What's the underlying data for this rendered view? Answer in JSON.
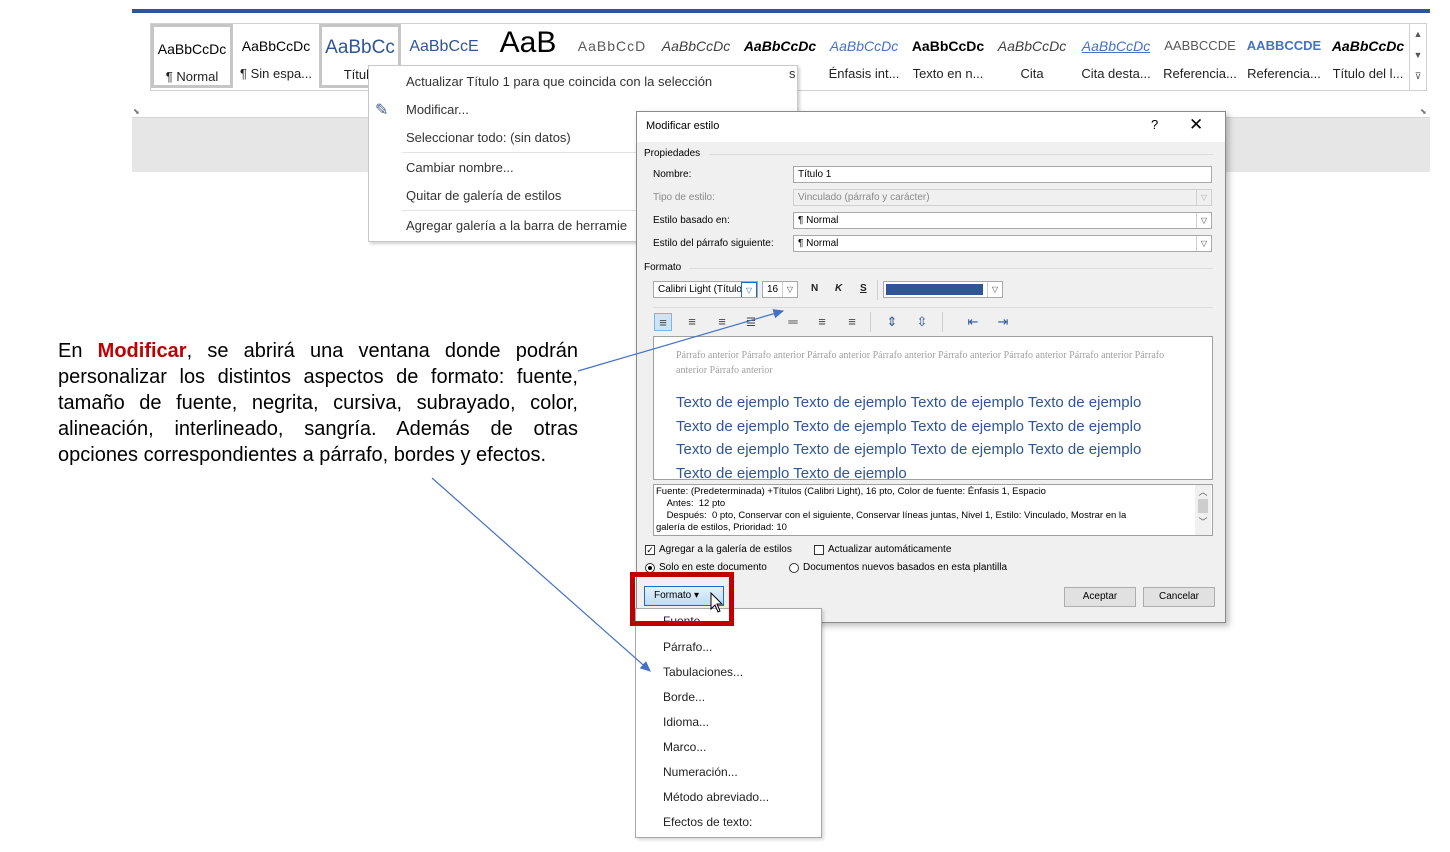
{
  "ribbon": {
    "styles": [
      {
        "preview": "AaBbCcDc",
        "label": "¶ Normal"
      },
      {
        "preview": "AaBbCcDc",
        "label": "¶ Sin espa..."
      },
      {
        "preview": "AaBbCc",
        "label": "Título"
      },
      {
        "preview": "AaBbCcE",
        "label": ""
      },
      {
        "preview": "AaB",
        "label": ""
      },
      {
        "preview": "AaBbCcD",
        "label": ""
      },
      {
        "preview": "AaBbCcDc",
        "label": ""
      },
      {
        "preview": "AaBbCcDc",
        "label": ""
      },
      {
        "preview": "AaBbCcDc",
        "label": "Énfasis int..."
      },
      {
        "preview": "AaBbCcDc",
        "label": "Texto en n..."
      },
      {
        "preview": "AaBbCcDc",
        "label": "Cita"
      },
      {
        "preview": "AaBbCcDc",
        "label": "Cita desta..."
      },
      {
        "preview": "AABBCCDE",
        "label": "Referencia..."
      },
      {
        "preview": "AABBCCDE",
        "label": "Referencia..."
      },
      {
        "preview": "AaBbCcDc",
        "label": "Título del l..."
      }
    ],
    "scroll_up": "▲",
    "scroll_down": "▼",
    "scroll_more": "⊽",
    "brand_color": "#2b579a"
  },
  "context_menu": {
    "items": [
      "Actualizar Título 1 para que coincida con la selección",
      "Modificar...",
      "Seleccionar todo: (sin datos)",
      "Cambiar nombre...",
      "Quitar de galería de estilos",
      "Agregar galería a la barra de herramie"
    ],
    "partial_right": "s"
  },
  "dialog": {
    "title": "Modificar estilo",
    "help": "?",
    "close": "✕",
    "properties_heading": "Propiedades",
    "name_label": "Nombre:",
    "name_value": "Título 1",
    "type_label": "Tipo de estilo:",
    "type_value": "Vinculado (párrafo y carácter)",
    "based_label": "Estilo basado en:",
    "based_value": "¶  Normal",
    "next_label": "Estilo del párrafo siguiente:",
    "next_value": "¶  Normal",
    "format_heading": "Formato",
    "font_value": "Calibri Light (Título",
    "size_value": "16",
    "bold": "N",
    "italic": "K",
    "underline": "S",
    "font_color": "#2f5597",
    "preview_previous": "Párrafo anterior Párrafo anterior Párrafo anterior Párrafo anterior Párrafo anterior Párrafo anterior Párrafo anterior Párrafo anterior Párrafo anterior",
    "preview_sample": "Texto de ejemplo Texto de ejemplo Texto de ejemplo Texto de ejemplo Texto de ejemplo Texto de ejemplo Texto de ejemplo Texto de ejemplo Texto de ejemplo Texto de ejemplo Texto de ejemplo Texto de ejemplo Texto de ejemplo Texto de ejemplo",
    "description": "Fuente: (Predeterminada) +Títulos (Calibri Light), 16 pto, Color de fuente: Énfasis 1, Espacio\n    Antes:  12 pto\n    Después:  0 pto, Conservar con el siguiente, Conservar líneas juntas, Nivel 1, Estilo: Vinculado, Mostrar en la\ngalería de estilos, Prioridad: 10",
    "add_gallery_label": "Agregar a la galería de estilos",
    "add_gallery_checked": true,
    "auto_update_label": "Actualizar automáticamente",
    "auto_update_checked": false,
    "only_doc_label": "Solo en este documento",
    "new_docs_label": "Documentos nuevos basados en esta plantilla",
    "format_button": "Formato ▾",
    "accept_button": "Aceptar",
    "cancel_button": "Cancelar"
  },
  "format_menu": {
    "items": [
      "Fuente...",
      "Párrafo...",
      "Tabulaciones...",
      "Borde...",
      "Idioma...",
      "Marco...",
      "Numeración...",
      "Método abreviado...",
      "Efectos de texto:"
    ]
  },
  "explanation": {
    "prefix": "En ",
    "highlight": "Modificar",
    "body": ", se abrirá una ventana donde podrán personalizar los distintos aspectos de formato: fuente, tamaño de fuente, negrita, cursiva, subrayado, color, alineación, interlineado, sangría. Además de otras opciones correspondientes a párrafo, bordes y efectos.",
    "highlight_color": "#c00000"
  },
  "annotation_color": "#4472c4"
}
